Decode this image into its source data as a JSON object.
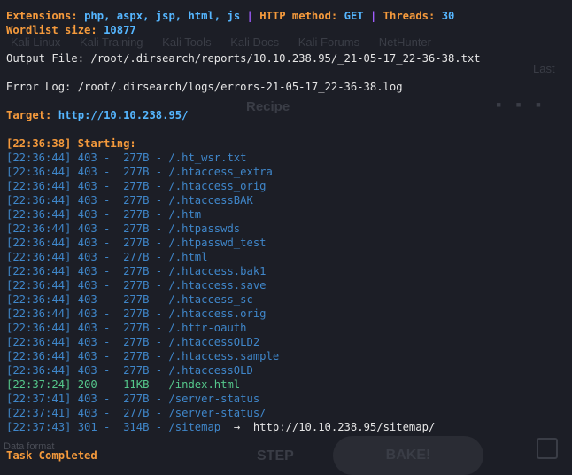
{
  "header": {
    "ext_label": "Extensions:",
    "ext_value": "php, aspx, jsp, html, js",
    "method_label": "HTTP method:",
    "method_value": "GET",
    "threads_label": "Threads:",
    "threads_value": "30",
    "wordlist_label": "Wordlist size:",
    "wordlist_value": "10877",
    "sep": "|"
  },
  "output_file": "Output File: /root/.dirsearch/reports/10.10.238.95/_21-05-17_22-36-38.txt",
  "error_log": "Error Log: /root/.dirsearch/logs/errors-21-05-17_22-36-38.log",
  "target_label": "Target:",
  "target_url": "http://10.10.238.95/",
  "starting": "[22:36:38] Starting:",
  "results": [
    {
      "time": "[22:36:44]",
      "code": "403",
      "size": "277B",
      "path": "/.ht_wsr.txt"
    },
    {
      "time": "[22:36:44]",
      "code": "403",
      "size": "277B",
      "path": "/.htaccess_extra"
    },
    {
      "time": "[22:36:44]",
      "code": "403",
      "size": "277B",
      "path": "/.htaccess_orig"
    },
    {
      "time": "[22:36:44]",
      "code": "403",
      "size": "277B",
      "path": "/.htaccessBAK"
    },
    {
      "time": "[22:36:44]",
      "code": "403",
      "size": "277B",
      "path": "/.htm"
    },
    {
      "time": "[22:36:44]",
      "code": "403",
      "size": "277B",
      "path": "/.htpasswds"
    },
    {
      "time": "[22:36:44]",
      "code": "403",
      "size": "277B",
      "path": "/.htpasswd_test"
    },
    {
      "time": "[22:36:44]",
      "code": "403",
      "size": "277B",
      "path": "/.html"
    },
    {
      "time": "[22:36:44]",
      "code": "403",
      "size": "277B",
      "path": "/.htaccess.bak1"
    },
    {
      "time": "[22:36:44]",
      "code": "403",
      "size": "277B",
      "path": "/.htaccess.save"
    },
    {
      "time": "[22:36:44]",
      "code": "403",
      "size": "277B",
      "path": "/.htaccess_sc"
    },
    {
      "time": "[22:36:44]",
      "code": "403",
      "size": "277B",
      "path": "/.htaccess.orig"
    },
    {
      "time": "[22:36:44]",
      "code": "403",
      "size": "277B",
      "path": "/.httr-oauth"
    },
    {
      "time": "[22:36:44]",
      "code": "403",
      "size": "277B",
      "path": "/.htaccessOLD2"
    },
    {
      "time": "[22:36:44]",
      "code": "403",
      "size": "277B",
      "path": "/.htaccess.sample"
    },
    {
      "time": "[22:36:44]",
      "code": "403",
      "size": "277B",
      "path": "/.htaccessOLD"
    },
    {
      "time": "[22:37:24]",
      "code": "200",
      "size": "11KB",
      "path": "/index.html"
    },
    {
      "time": "[22:37:41]",
      "code": "403",
      "size": "277B",
      "path": "/server-status"
    },
    {
      "time": "[22:37:41]",
      "code": "403",
      "size": "277B",
      "path": "/server-status/"
    },
    {
      "time": "[22:37:43]",
      "code": "301",
      "size": "314B",
      "path": "/sitemap",
      "redirect_arrow": "→",
      "redirect": "http://10.10.238.95/sitemap/"
    }
  ],
  "completed": "Task Completed",
  "background": {
    "tabs": [
      "Kali Linux",
      "Kali Training",
      "Kali Tools",
      "Kali Docs",
      "Kali Forums",
      "NetHunter"
    ],
    "recipe": "Recipe",
    "last": "Last",
    "step": "STEP",
    "bake": "BAKE!",
    "data_format": "Data format"
  },
  "colors": {
    "background": "#1c1e26",
    "orange": "#f59a3c",
    "cyan": "#55b6ff",
    "purple": "#a05cff",
    "blue": "#3f86c9",
    "green": "#55c78b"
  }
}
